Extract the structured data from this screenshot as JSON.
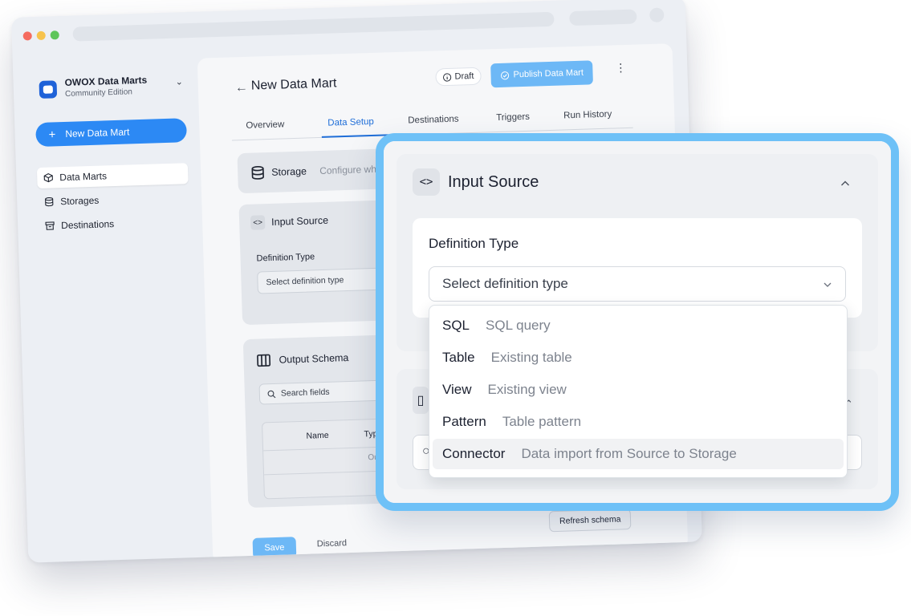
{
  "app": {
    "brand_name": "OWOX Data Marts",
    "brand_edition": "Community Edition",
    "new_button": "New Data Mart"
  },
  "sidebar": {
    "items": [
      {
        "label": "Data Marts",
        "icon": "cube-icon",
        "active": true
      },
      {
        "label": "Storages",
        "icon": "database-icon",
        "active": false
      },
      {
        "label": "Destinations",
        "icon": "archive-icon",
        "active": false
      }
    ]
  },
  "header": {
    "back_icon": "arrow-left-icon",
    "title": "New Data Mart",
    "status_badge": "Draft",
    "publish_label": "Publish Data Mart"
  },
  "tabs": [
    {
      "label": "Overview",
      "active": false
    },
    {
      "label": "Data Setup",
      "active": true
    },
    {
      "label": "Destinations",
      "active": false
    },
    {
      "label": "Triggers",
      "active": false
    },
    {
      "label": "Run History",
      "active": false
    }
  ],
  "storage_section": {
    "title": "Storage",
    "hint": "Configure wh"
  },
  "input_source": {
    "title": "Input Source",
    "icon": "code-brackets-icon",
    "definition_label": "Definition Type",
    "select_placeholder": "Select definition type",
    "options": [
      {
        "label": "SQL",
        "desc": "SQL query"
      },
      {
        "label": "Table",
        "desc": "Existing table"
      },
      {
        "label": "View",
        "desc": "Existing view"
      },
      {
        "label": "Pattern",
        "desc": "Table pattern"
      },
      {
        "label": "Connector",
        "desc": "Data import from Source to Storage"
      }
    ]
  },
  "output_schema": {
    "title": "Output Schema",
    "search_placeholder": "Search fields",
    "columns": [
      "Name",
      "Type"
    ],
    "empty_text": "Outp"
  },
  "footer": {
    "save_label": "Save",
    "discard_label": "Discard",
    "refresh_label": "Refresh schema"
  },
  "colors": {
    "accent": "#2c89f4",
    "frame": "#6ec1f7",
    "publish": "#6db8f6"
  }
}
